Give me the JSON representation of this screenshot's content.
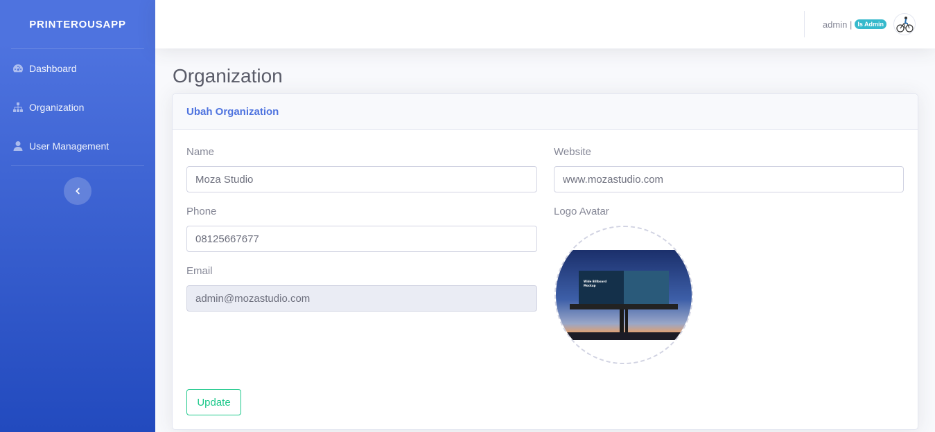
{
  "sidebar": {
    "brand": "PRINTEROUSAPP",
    "items": [
      {
        "label": "Dashboard",
        "icon": "tachometer-icon"
      },
      {
        "label": "Organization",
        "icon": "sitemap-icon"
      },
      {
        "label": "User Management",
        "icon": "user-icon"
      }
    ],
    "toggle_icon": "chevron-left-icon"
  },
  "topbar": {
    "user_name": "admin |",
    "role_badge": "Is Admin",
    "avatar_icon": "cyclist-avatar-icon"
  },
  "page": {
    "title": "Organization"
  },
  "card": {
    "header": "Ubah Organization",
    "fields": {
      "name": {
        "label": "Name",
        "value": "Moza Studio"
      },
      "phone": {
        "label": "Phone",
        "value": "08125667677"
      },
      "email": {
        "label": "Email",
        "value": "admin@mozastudio.com"
      },
      "website": {
        "label": "Website",
        "value": "www.mozastudio.com"
      },
      "logo": {
        "label": "Logo Avatar",
        "image": "billboard-mockup-image",
        "billboard_text": "Wide Billboard Mockup"
      }
    },
    "update_label": "Update"
  },
  "colors": {
    "primary": "#4e73df",
    "success": "#1cc88a",
    "info": "#36b9cc"
  }
}
